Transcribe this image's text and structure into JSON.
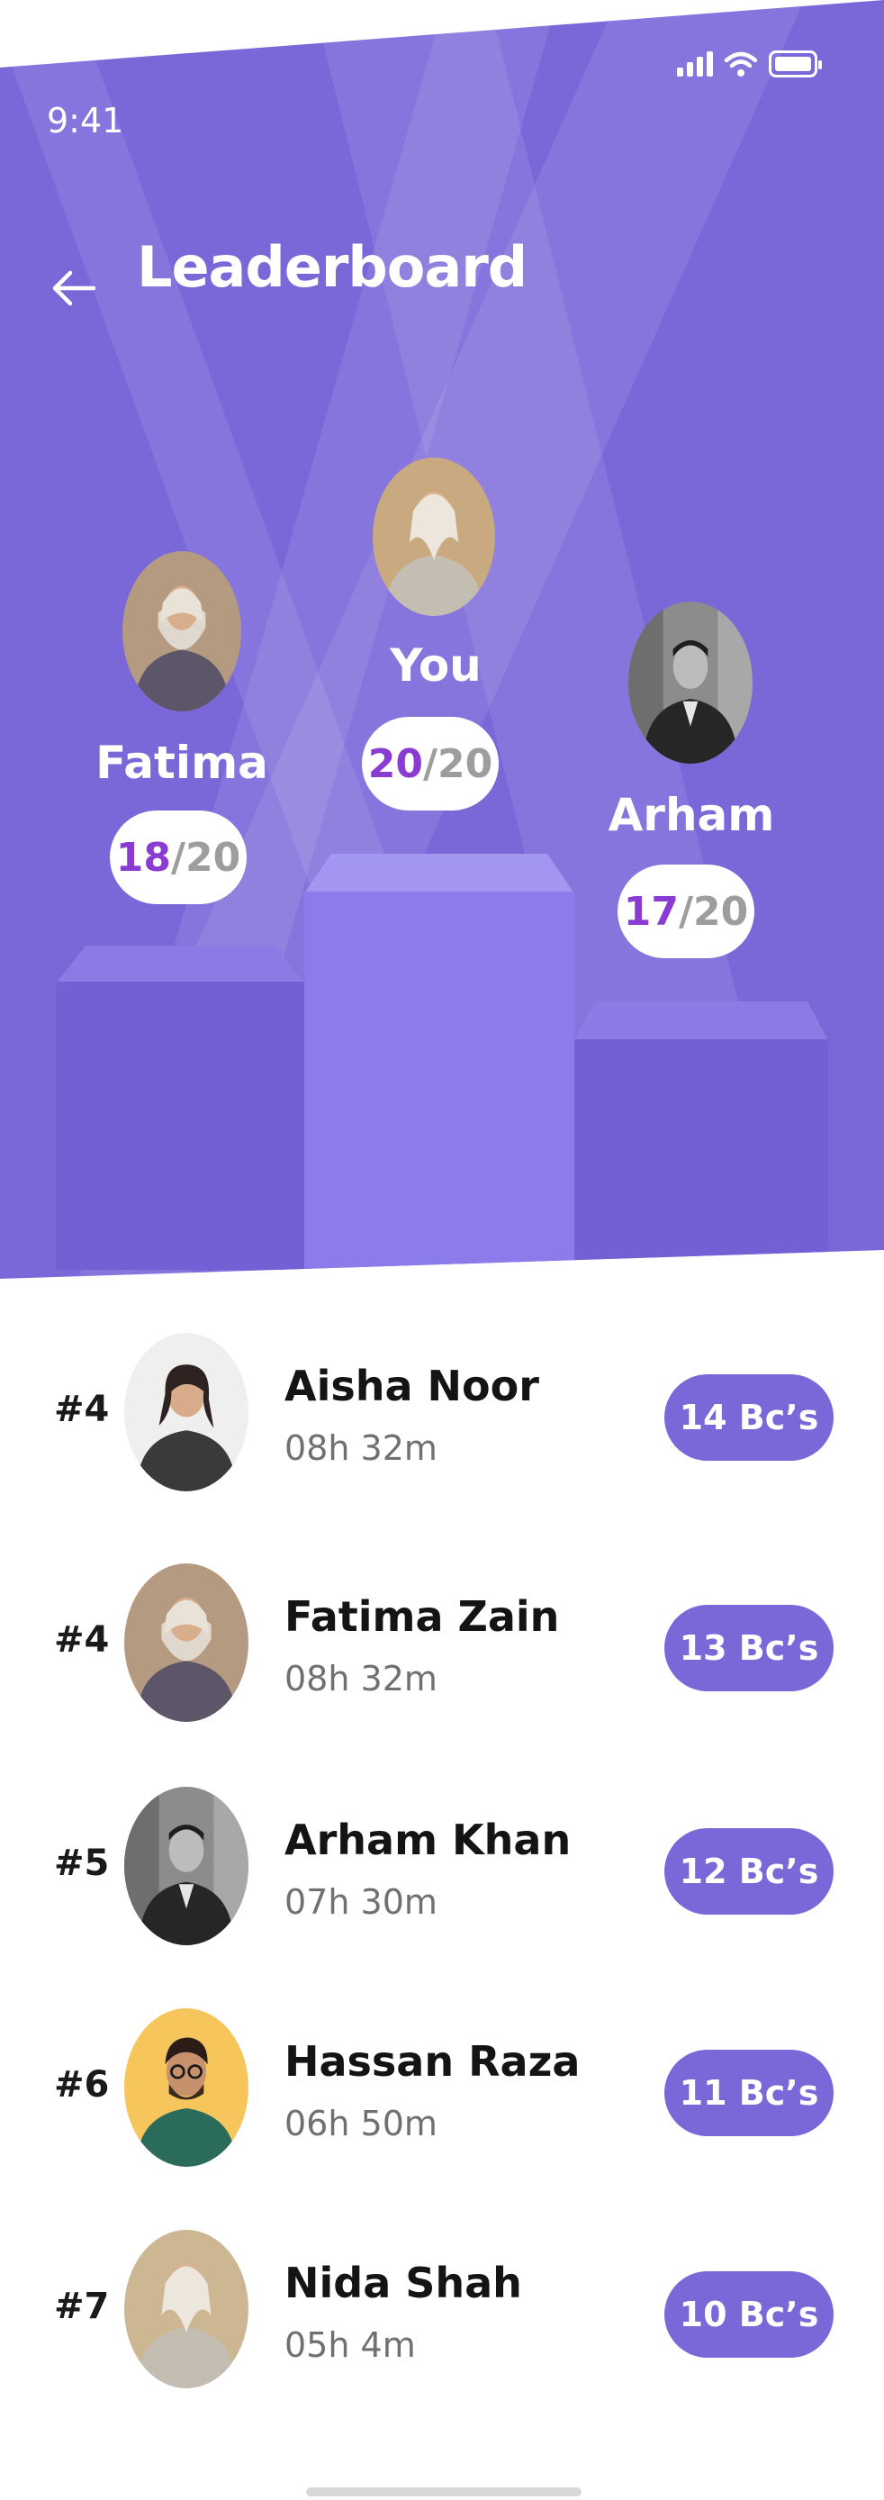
{
  "status_bar": {
    "time": "9:41"
  },
  "header": {
    "title": "Leaderboard"
  },
  "podium": [
    {
      "name": "Fatima",
      "score": "18",
      "total": "20"
    },
    {
      "name": "You",
      "score": "20",
      "total": "20"
    },
    {
      "name": "Arham",
      "score": "17",
      "total": "20"
    }
  ],
  "ranking": [
    {
      "rank": "#4",
      "name": "Aisha Noor",
      "time": "08h 32m",
      "badge": "14 Bc’s"
    },
    {
      "rank": "#4",
      "name": "Fatima Zain",
      "time": "08h 32m",
      "badge": "13 Bc’s"
    },
    {
      "rank": "#5",
      "name": "Arham Khan",
      "time": "07h 30m",
      "badge": "12 Bc’s"
    },
    {
      "rank": "#6",
      "name": "Hassan Raza",
      "time": "06h 50m",
      "badge": "11 Bc’s"
    },
    {
      "rank": "#7",
      "name": "Nida Shah",
      "time": "05h 4m",
      "badge": "10 Bc’s"
    }
  ],
  "colors": {
    "primary": "#7a68d9",
    "accent": "#8a3bd2",
    "text": "#141414",
    "muted": "#707070"
  }
}
